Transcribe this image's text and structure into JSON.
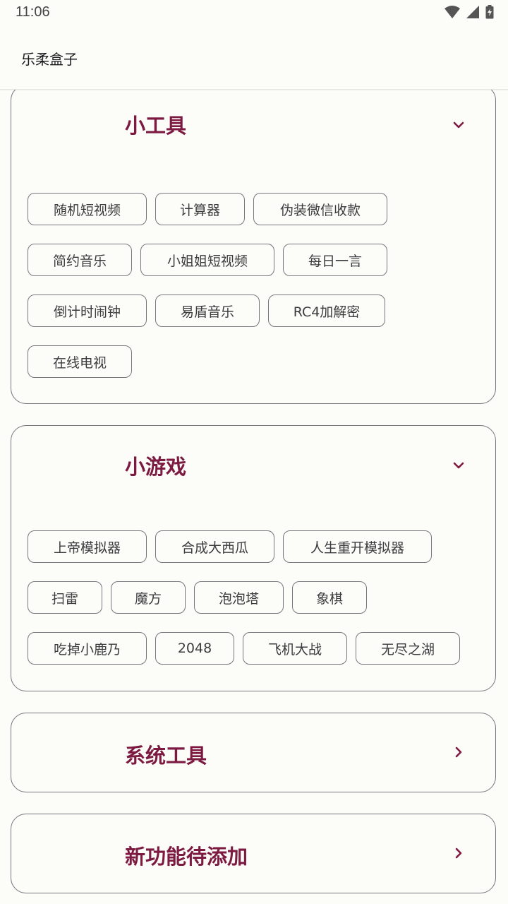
{
  "status_bar": {
    "time": "11:06",
    "icons": [
      "wifi-icon",
      "signal-icon",
      "battery-charging-icon"
    ]
  },
  "app_bar": {
    "title": "乐柔盒子"
  },
  "sections": {
    "tools": {
      "title": "小工具",
      "expanded": true,
      "chips": [
        "随机短视频",
        "计算器",
        "伪装微信收款",
        "简约音乐",
        "小姐姐短视频",
        "每日一言",
        "倒计时闹钟",
        "易盾音乐",
        "RC4加解密",
        "在线电视"
      ]
    },
    "games": {
      "title": "小游戏",
      "expanded": true,
      "chips": [
        "上帝模拟器",
        "合成大西瓜",
        "人生重开模拟器",
        "扫雷",
        "魔方",
        "泡泡塔",
        "象棋",
        "吃掉小鹿乃",
        "2048",
        "飞机大战",
        "无尽之湖"
      ]
    },
    "system": {
      "title": "系统工具",
      "expanded": false
    },
    "pending": {
      "title": "新功能待添加",
      "expanded": false
    }
  },
  "colors": {
    "accent": "#7d1a41",
    "outline": "#79747e",
    "background": "#fcfcf8"
  }
}
